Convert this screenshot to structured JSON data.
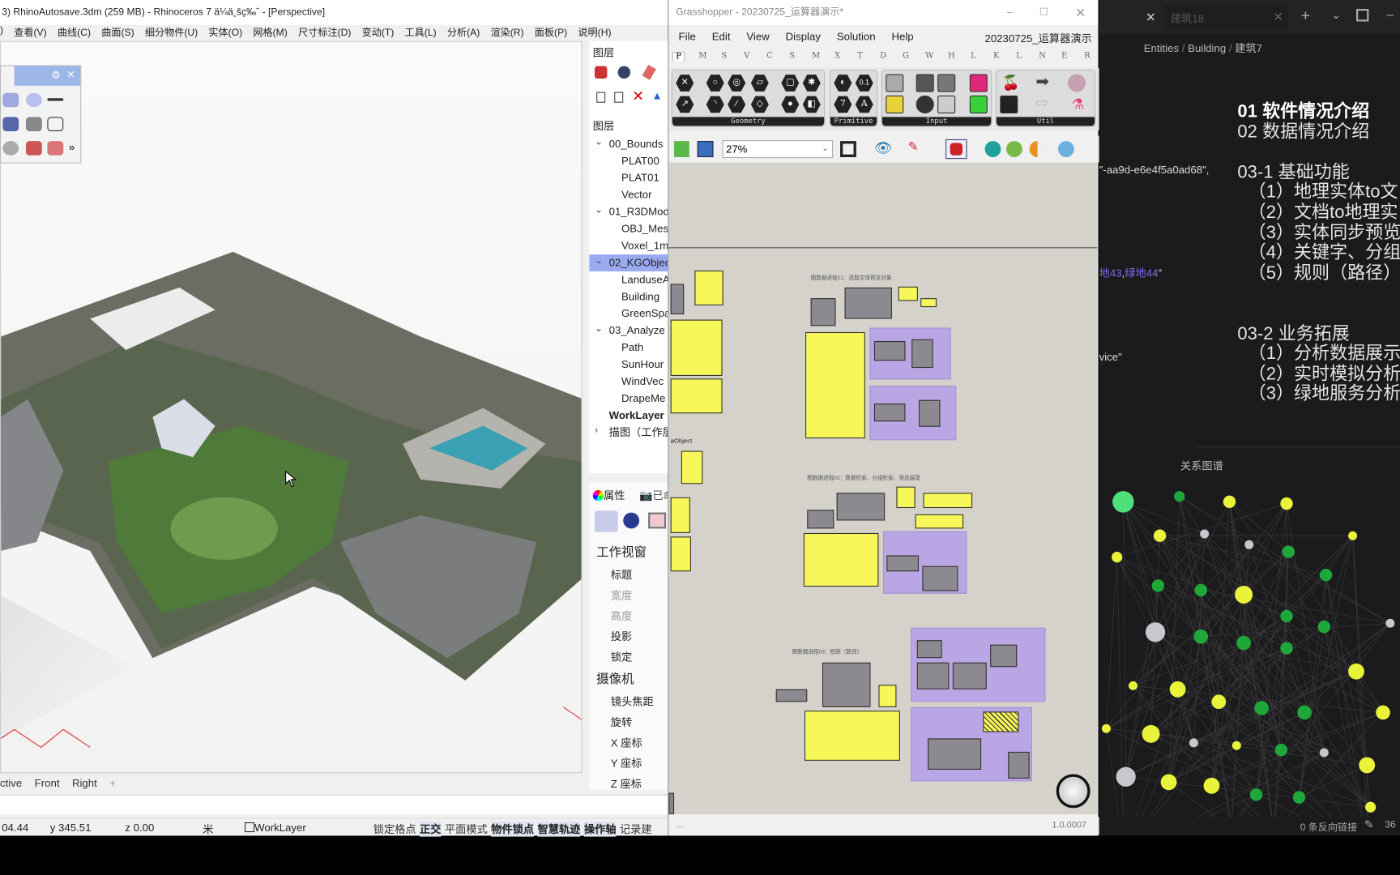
{
  "rhino": {
    "title": "3) RhinoAutosave.3dm (259 MB) - Rhinoceros 7 ä¼ä¸šç‰ˆ - [Perspective]",
    "menu": [
      ")",
      "查看(V)",
      "曲线(C)",
      "曲面(S)",
      "细分物件(U)",
      "实体(O)",
      "网格(M)",
      "尺寸标注(D)",
      "变动(T)",
      "工具(L)",
      "分析(A)",
      "渲染(R)",
      "面板(P)",
      "说明(H)"
    ],
    "layers_panel": {
      "tab_title": "图层",
      "header": "图层",
      "items": [
        {
          "label": "00_Bounds",
          "level": 0,
          "expanded": true
        },
        {
          "label": "PLAT00",
          "level": 1
        },
        {
          "label": "PLAT01",
          "level": 1
        },
        {
          "label": "Vector",
          "level": 1
        },
        {
          "label": "01_R3DMod",
          "level": 0,
          "expanded": true
        },
        {
          "label": "OBJ_Mes",
          "level": 1
        },
        {
          "label": "Voxel_1m",
          "level": 1
        },
        {
          "label": "02_KGObjec",
          "level": 0,
          "expanded": true,
          "selected": true
        },
        {
          "label": "LanduseA",
          "level": 1
        },
        {
          "label": "Building",
          "level": 1
        },
        {
          "label": "GreenSpa",
          "level": 1
        },
        {
          "label": "03_Analyze",
          "level": 0,
          "expanded": true
        },
        {
          "label": "Path",
          "level": 1
        },
        {
          "label": "SunHour",
          "level": 1
        },
        {
          "label": "WindVec",
          "level": 1
        },
        {
          "label": "DrapeMe",
          "level": 1
        },
        {
          "label": "WorkLayer",
          "level": 0,
          "bold": true
        },
        {
          "label": "描图（工作层",
          "level": 0,
          "collapsed": true
        }
      ]
    },
    "properties_panel": {
      "tab_properties": "属性",
      "tab_named": "已命",
      "section_viewport": "工作视窗",
      "viewport_fields": [
        "标题",
        "宽度",
        "高度",
        "投影",
        "锁定"
      ],
      "section_camera": "摄像机",
      "camera_fields": [
        "镜头焦距",
        "旋转",
        "X 座标",
        "Y 座标",
        "Z 座标"
      ]
    },
    "viewport_tabs": [
      "ctive",
      "Front",
      "Right",
      "+"
    ],
    "status_bar": {
      "x": "04.44",
      "y": "y 345.51",
      "z": "z 0.00",
      "unit": "米",
      "layer": "WorkLayer",
      "toggles": [
        {
          "label": "锁定格点",
          "on": false
        },
        {
          "label": "正交",
          "on": true
        },
        {
          "label": "平面模式",
          "on": false
        },
        {
          "label": "物件锁点",
          "on": true
        },
        {
          "label": "智慧轨迹",
          "on": true
        },
        {
          "label": "操作轴",
          "on": true
        },
        {
          "label": "记录建",
          "on": false
        }
      ]
    }
  },
  "grasshopper": {
    "title": "Grasshopper - 20230725_运算器演示*",
    "menu": [
      "File",
      "Edit",
      "View",
      "Display",
      "Solution",
      "Help"
    ],
    "document_name": "20230725_运算器演示",
    "tabs": [
      "P",
      "M",
      "S",
      "V",
      "C",
      "S",
      "M",
      "X",
      "T",
      "D",
      "G",
      "W",
      "H",
      "L",
      "K",
      "L",
      "N",
      "E",
      "R"
    ],
    "ribbon_groups": [
      "Geometry",
      "Primitive",
      "Input",
      "Util"
    ],
    "primitive_glyphs": [
      "0.1",
      "7",
      "A"
    ],
    "zoom": "27%",
    "canvas_labels": [
      "aObject",
      "图数据进程01：选取实体预览对象",
      "图数据进程02：数据检索、分组检索、筛选展现",
      "图数据进程03：规则（路径）"
    ],
    "status_left": "...",
    "version": "1.0.0007"
  },
  "knowledge_panel": {
    "tab_inactive": "建筑18",
    "breadcrumb": [
      "Entities",
      "Building",
      "建筑7"
    ],
    "code_fragments": [
      "\"-aa9d-e6e4f5a0ad68\",",
      "地43",
      "绿地44",
      "\"",
      "vice\""
    ],
    "outline": [
      {
        "text": "01 软件情况介绍",
        "bold": true
      },
      {
        "text": "02 数据情况介绍"
      },
      {
        "text": ""
      },
      {
        "text": "03-1 基础功能"
      },
      {
        "text": "（1）地理实体to文"
      },
      {
        "text": "（2）文档to地理实"
      },
      {
        "text": "（3）实体同步预览"
      },
      {
        "text": "（4）关键字、分组"
      },
      {
        "text": "（5）规则（路径）"
      },
      {
        "text": ""
      },
      {
        "text": ""
      },
      {
        "text": "03-2 业务拓展"
      },
      {
        "text": "（1）分析数据展示"
      },
      {
        "text": "（2）实时模拟分析"
      },
      {
        "text": "（3）绿地服务分析"
      }
    ],
    "graph_title": "关系图谱",
    "backlinks": "0 条反向链接",
    "word_count": "36",
    "node_colors": {
      "green": "#1fa83a",
      "yellow": "#e8f33a",
      "gray": "#c8c8cc",
      "light_green": "#4ee07a",
      "purple": "#8f6fe0"
    }
  }
}
